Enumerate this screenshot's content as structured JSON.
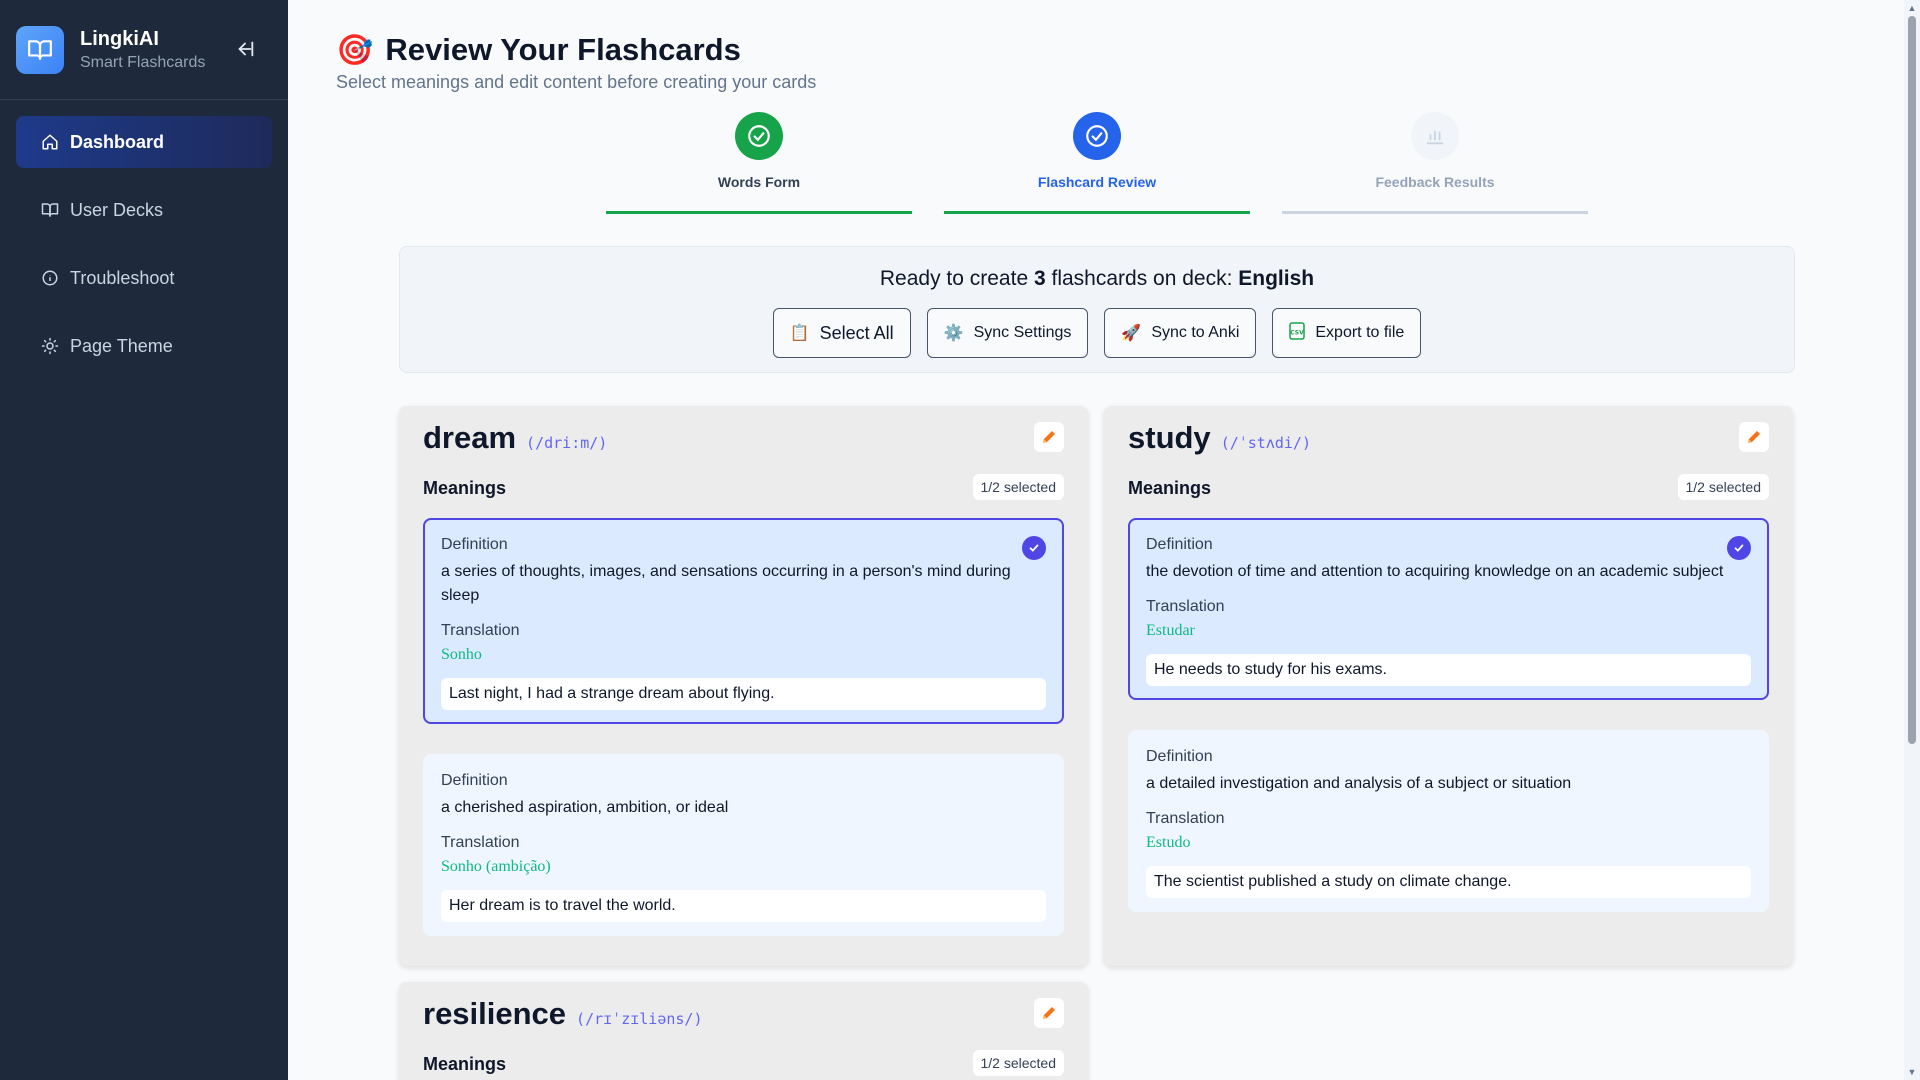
{
  "sidebar": {
    "brand_name": "LingkiAI",
    "brand_sub": "Smart Flashcards",
    "items": [
      {
        "label": "Dashboard",
        "icon": "home-icon",
        "active": true
      },
      {
        "label": "User Decks",
        "icon": "book-icon",
        "active": false
      },
      {
        "label": "Troubleshoot",
        "icon": "info-icon",
        "active": false
      },
      {
        "label": "Page Theme",
        "icon": "sun-icon",
        "active": false
      }
    ]
  },
  "header": {
    "emoji": "🎯",
    "title": "Review Your Flashcards",
    "subtitle": "Select meanings and edit content before creating your cards"
  },
  "steps": [
    {
      "label": "Words Form",
      "state": "done",
      "color": "#16a34a"
    },
    {
      "label": "Flashcard Review",
      "state": "active",
      "color": "#2563eb"
    },
    {
      "label": "Feedback Results",
      "state": "pending",
      "color": "#94a3b8"
    }
  ],
  "panel": {
    "ready_prefix": "Ready to create ",
    "count": "3",
    "ready_mid": " flashcards on deck: ",
    "deck": "English",
    "buttons": {
      "select_all": "Select All",
      "sync_settings": "Sync Settings",
      "sync_anki": "Sync to Anki",
      "export": "Export to file"
    }
  },
  "cards": [
    {
      "word": "dream",
      "ipa": "(/dri:m/)",
      "meanings_label": "Meanings",
      "selected_badge": "1/2 selected",
      "meanings": [
        {
          "def_label": "Definition",
          "definition": "a series of thoughts, images, and sensations occurring in a person's mind during sleep",
          "trans_label": "Translation",
          "translation": "Sonho",
          "example": "Last night, I had a strange dream about flying.",
          "selected": true
        },
        {
          "def_label": "Definition",
          "definition": "a cherished aspiration, ambition, or ideal",
          "trans_label": "Translation",
          "translation": "Sonho (ambição)",
          "example": "Her dream is to travel the world.",
          "selected": false
        }
      ]
    },
    {
      "word": "study",
      "ipa": "(/ˈstʌdi/)",
      "meanings_label": "Meanings",
      "selected_badge": "1/2 selected",
      "meanings": [
        {
          "def_label": "Definition",
          "definition": "the devotion of time and attention to acquiring knowledge on an academic subject",
          "trans_label": "Translation",
          "translation": "Estudar",
          "example": "He needs to study for his exams.",
          "selected": true
        },
        {
          "def_label": "Definition",
          "definition": "a detailed investigation and analysis of a subject or situation",
          "trans_label": "Translation",
          "translation": "Estudo",
          "example": "The scientist published a study on climate change.",
          "selected": false
        }
      ]
    },
    {
      "word": "resilience",
      "ipa": "(/rɪˈzɪliəns/)",
      "meanings_label": "Meanings",
      "selected_badge": "1/2 selected"
    }
  ]
}
